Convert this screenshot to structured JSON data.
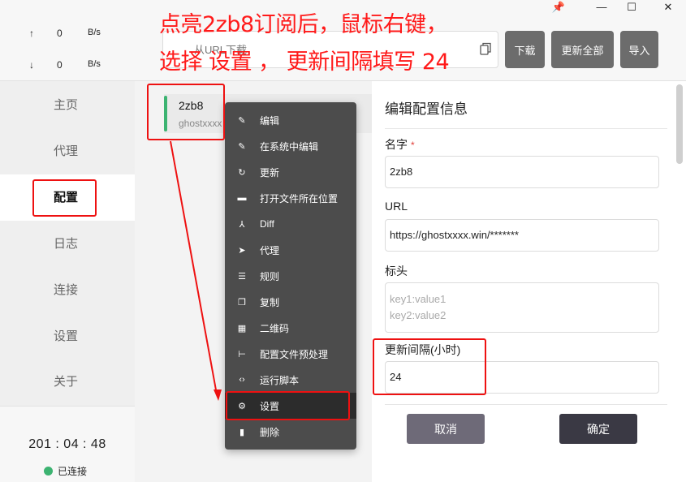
{
  "window": {
    "pin": "📌",
    "minimize": "—",
    "maximize": "☐",
    "close": "✕"
  },
  "traffic": {
    "up_arrow": "↑",
    "up_value": "0",
    "up_unit": "B/s",
    "down_arrow": "↓",
    "down_value": "0",
    "down_unit": "B/s"
  },
  "sidebar": {
    "items": [
      {
        "label": "主页"
      },
      {
        "label": "代理"
      },
      {
        "label": "配置"
      },
      {
        "label": "日志"
      },
      {
        "label": "连接"
      },
      {
        "label": "设置"
      },
      {
        "label": "关于"
      }
    ],
    "active": "配置"
  },
  "status": {
    "uptime": "201 : 04 : 48",
    "connection": "已连接",
    "connection_color": "#3cb371"
  },
  "header": {
    "url_placeholder": "从URL下载",
    "download_label": "下载",
    "update_all_label": "更新全部",
    "import_label": "导入"
  },
  "profile": {
    "name": "2zb8",
    "subtitle": "ghostxxxx",
    "accent_color": "#3cb371"
  },
  "context_menu": {
    "items": [
      {
        "label": "编辑",
        "icon": "pencil-icon",
        "glyph": "✎"
      },
      {
        "label": "在系统中编辑",
        "icon": "pencil-icon",
        "glyph": "✎"
      },
      {
        "label": "更新",
        "icon": "refresh-icon",
        "glyph": "↻"
      },
      {
        "label": "打开文件所在位置",
        "icon": "folder-icon",
        "glyph": "▬"
      },
      {
        "label": "Diff",
        "icon": "diff-icon",
        "glyph": "⅄"
      },
      {
        "label": "代理",
        "icon": "send-icon",
        "glyph": "➤"
      },
      {
        "label": "规则",
        "icon": "rules-icon",
        "glyph": "☰"
      },
      {
        "label": "复制",
        "icon": "copy-icon",
        "glyph": "❐"
      },
      {
        "label": "二维码",
        "icon": "qrcode-icon",
        "glyph": "▦"
      },
      {
        "label": "配置文件预处理",
        "icon": "tree-icon",
        "glyph": "⊢"
      },
      {
        "label": "运行脚本",
        "icon": "code-icon",
        "glyph": "‹›"
      },
      {
        "label": "设置",
        "icon": "gear-icon",
        "glyph": "⚙"
      },
      {
        "label": "删除",
        "icon": "trash-icon",
        "glyph": "▮"
      }
    ],
    "active": "设置"
  },
  "edit_panel": {
    "title": "编辑配置信息",
    "name_label": "名字",
    "required_mark": "*",
    "name_value": "2zb8",
    "url_label": "URL",
    "url_value": "https://ghostxxxx.win/*******",
    "headers_label": "标头",
    "headers_placeholder_1": "key1:value1",
    "headers_placeholder_2": "key2:value2",
    "interval_label": "更新间隔(小时)",
    "interval_value": "24",
    "cancel_label": "取消",
    "confirm_label": "确定"
  },
  "annotation": {
    "line1": "点亮2zb8订阅后，鼠标右键，",
    "line2": "选择 设置 ， 更新间隔填写 24",
    "color": "#ff1a1a"
  }
}
